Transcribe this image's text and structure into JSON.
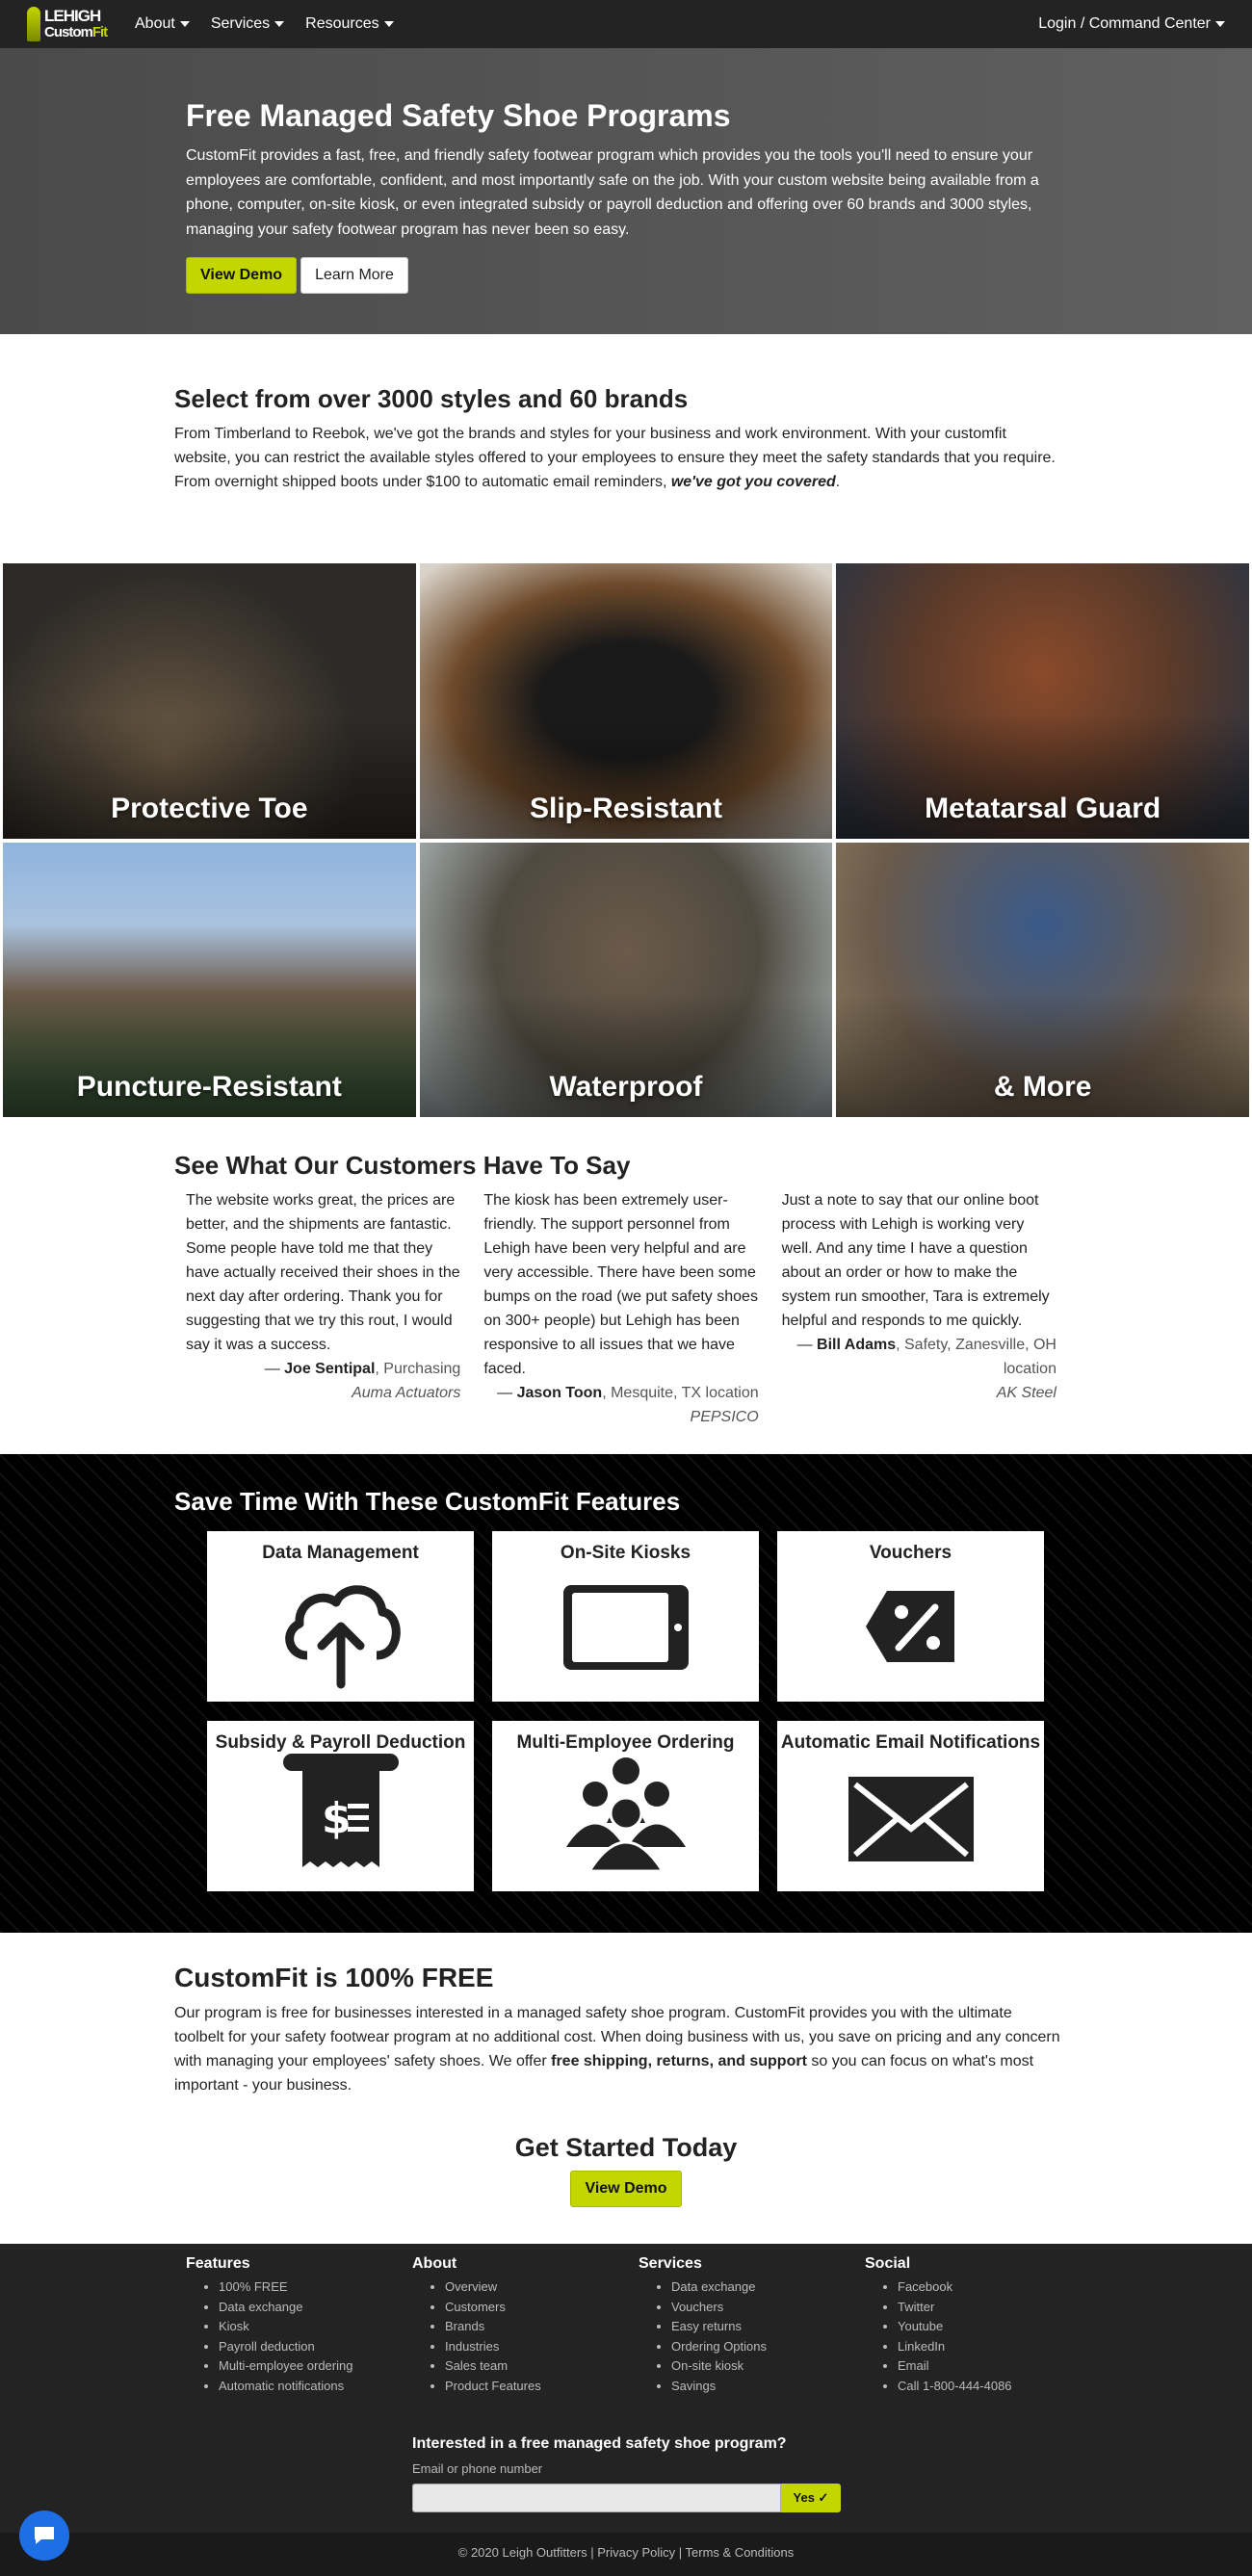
{
  "nav": {
    "logo_line1": "LEHIGH",
    "logo_line2a": "Custom",
    "logo_line2b": "Fit",
    "items": [
      "About",
      "Services",
      "Resources"
    ],
    "login": "Login / Command Center"
  },
  "hero": {
    "title": "Free Managed Safety Shoe Programs",
    "text": "CustomFit provides a fast, free, and friendly safety footwear program which provides you the tools you'll need to ensure your employees are comfortable, confident, and most importantly safe on the job. With your custom website being available from a phone, computer, on-site kiosk, or even integrated subsidy or payroll deduction and offering over 60 brands and 3000 styles, managing your safety footwear program has never been so easy.",
    "demo_btn": "View Demo",
    "learn_btn": "Learn More"
  },
  "styles": {
    "title": "Select from over 3000 styles and 60 brands",
    "text": "From Timberland to Reebok, we've got the brands and styles for your business and work environment. With your customfit website, you can restrict the available styles offered to your employees to ensure they meet the safety standards that you require. From overnight shipped boots under $100 to automatic email reminders, ",
    "text_em": "we've got you covered",
    "text_end": "."
  },
  "tiles": [
    "Protective Toe",
    "Slip-Resistant",
    "Metatarsal Guard",
    "Puncture-Resistant",
    "Waterproof",
    "& More"
  ],
  "testimonials": {
    "title": "See What Our Customers Have To Say",
    "items": [
      {
        "quote": "The website works great, the prices are better, and the shipments are fantastic. Some people have told me that they have actually received their shoes in the next day after ordering. Thank you for suggesting that we try this rout, I would say it was a success.",
        "name": "Joe Sentipal",
        "role": ", Purchasing",
        "company": "Auma Actuators"
      },
      {
        "quote": "The kiosk has been extremely user-friendly. The support personnel from Lehigh have been very helpful and are very accessible. There have been some bumps on the road (we put safety shoes on 300+ people) but Lehigh has been responsive to all issues that we have faced.",
        "name": "Jason Toon",
        "role": ", Mesquite, TX location",
        "company": "PEPSICO"
      },
      {
        "quote": "Just a note to say that our online boot process with Lehigh is working very well. And any time I have a question about an order or how to make the system run smoother, Tara is extremely helpful and responds to me quickly.",
        "name": "Bill Adams",
        "role": ", Safety, Zanesville, OH location",
        "company": "AK Steel"
      }
    ]
  },
  "features": {
    "title": "Save Time With These CustomFit Features",
    "cards": [
      {
        "title": "Data Management",
        "icon": "cloud-upload-icon"
      },
      {
        "title": "On-Site Kiosks",
        "icon": "tablet-icon"
      },
      {
        "title": "Vouchers",
        "icon": "percent-tag-icon"
      },
      {
        "title": "Subsidy & Payroll Deduction",
        "icon": "receipt-icon"
      },
      {
        "title": "Multi-Employee Ordering",
        "icon": "users-icon"
      },
      {
        "title": "Automatic Email Notifications",
        "icon": "envelope-icon"
      }
    ]
  },
  "free": {
    "title": "CustomFit is 100% FREE",
    "text1": "Our program is free for businesses interested in a managed safety shoe program. CustomFit provides you with the ultimate toolbelt for your safety footwear program at no additional cost. When doing business with us, you save on pricing and any concern with managing your employees' safety shoes. We offer ",
    "bold": "free shipping, returns, and support",
    "text2": " so you can focus on what's most important - your business."
  },
  "get_started": {
    "title": "Get Started Today",
    "button": "View Demo"
  },
  "footer": {
    "cols": [
      {
        "title": "Features",
        "links": [
          "100% FREE",
          "Data exchange",
          "Kiosk",
          "Payroll deduction",
          "Multi-employee ordering",
          "Automatic notifications"
        ]
      },
      {
        "title": "About",
        "links": [
          "Overview",
          "Customers",
          "Brands",
          "Industries",
          "Sales team",
          "Product Features"
        ]
      },
      {
        "title": "Services",
        "links": [
          "Data exchange",
          "Vouchers",
          "Easy returns",
          "Ordering Options",
          "On-site kiosk",
          "Savings"
        ]
      },
      {
        "title": "Social",
        "links": [
          "Facebook",
          "Twitter",
          "Youtube",
          "LinkedIn",
          "Email",
          "Call 1-800-444-4086"
        ]
      }
    ],
    "signup_title": "Interested in a free managed safety shoe program?",
    "signup_label": "Email or phone number",
    "signup_button": "Yes ✓",
    "copyright": "© 2020 Leigh Outfitters | Privacy Policy | Terms & Conditions"
  },
  "colors": {
    "accent": "#c4d600",
    "nav": "#232323",
    "chat": "#1e6ee6"
  }
}
